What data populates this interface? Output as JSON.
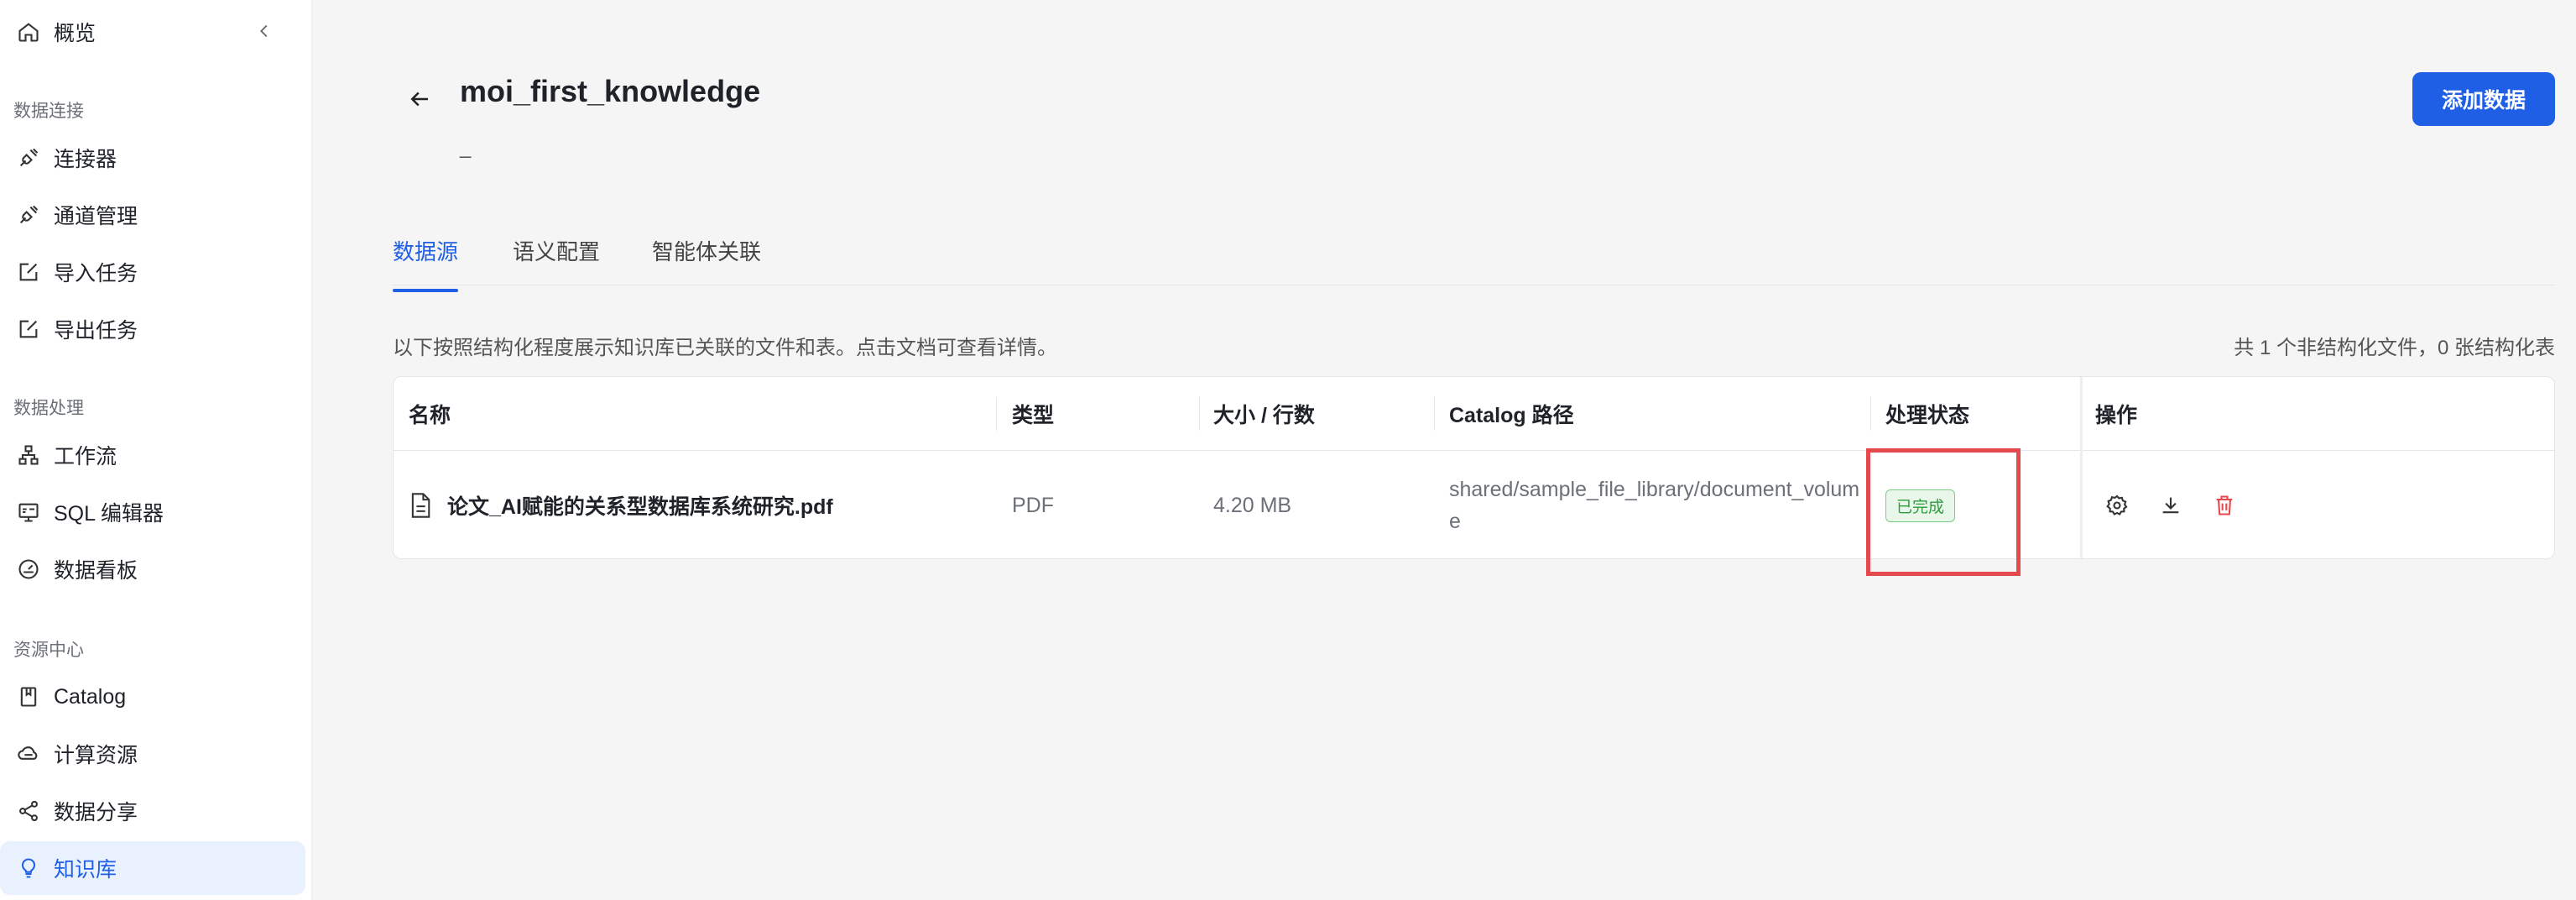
{
  "sidebar": {
    "overview_label": "概览",
    "sections": {
      "data_connection": "数据连接",
      "data_processing": "数据处理",
      "resource_center": "资源中心"
    },
    "items": [
      {
        "label": "连接器",
        "icon": "plug-icon"
      },
      {
        "label": "通道管理",
        "icon": "plug-icon"
      },
      {
        "label": "导入任务",
        "icon": "edit-icon"
      },
      {
        "label": "导出任务",
        "icon": "edit-icon"
      },
      {
        "label": "工作流",
        "icon": "workflow-icon"
      },
      {
        "label": "SQL 编辑器",
        "icon": "sql-icon"
      },
      {
        "label": "数据看板",
        "icon": "gauge-icon"
      },
      {
        "label": "Catalog",
        "icon": "book-icon"
      },
      {
        "label": "计算资源",
        "icon": "cloud-icon"
      },
      {
        "label": "数据分享",
        "icon": "share-icon"
      },
      {
        "label": "知识库",
        "icon": "bulb-icon"
      }
    ],
    "active_item": "知识库"
  },
  "header": {
    "title": "moi_first_knowledge",
    "description": "_",
    "add_button": "添加数据"
  },
  "tabs": [
    {
      "label": "数据源",
      "active": true
    },
    {
      "label": "语义配置",
      "active": false
    },
    {
      "label": "智能体关联",
      "active": false
    }
  ],
  "info_text": "以下按照结构化程度展示知识库已关联的文件和表。点击文档可查看详情。",
  "summary_text": "共 1 个非结构化文件，0 张结构化表",
  "table": {
    "columns": [
      "名称",
      "类型",
      "大小 / 行数",
      "Catalog 路径",
      "处理状态",
      "操作"
    ],
    "rows": [
      {
        "name": "论文_AI赋能的关系型数据库系统研究.pdf",
        "type": "PDF",
        "size": "4.20 MB",
        "path": "shared/sample_file_library/document_volume",
        "status": "已完成"
      }
    ]
  },
  "colors": {
    "accent": "#1f5fe6",
    "status_green": "#2d9d3a",
    "delete_red": "#e5484d",
    "highlight": "#e5484d"
  }
}
